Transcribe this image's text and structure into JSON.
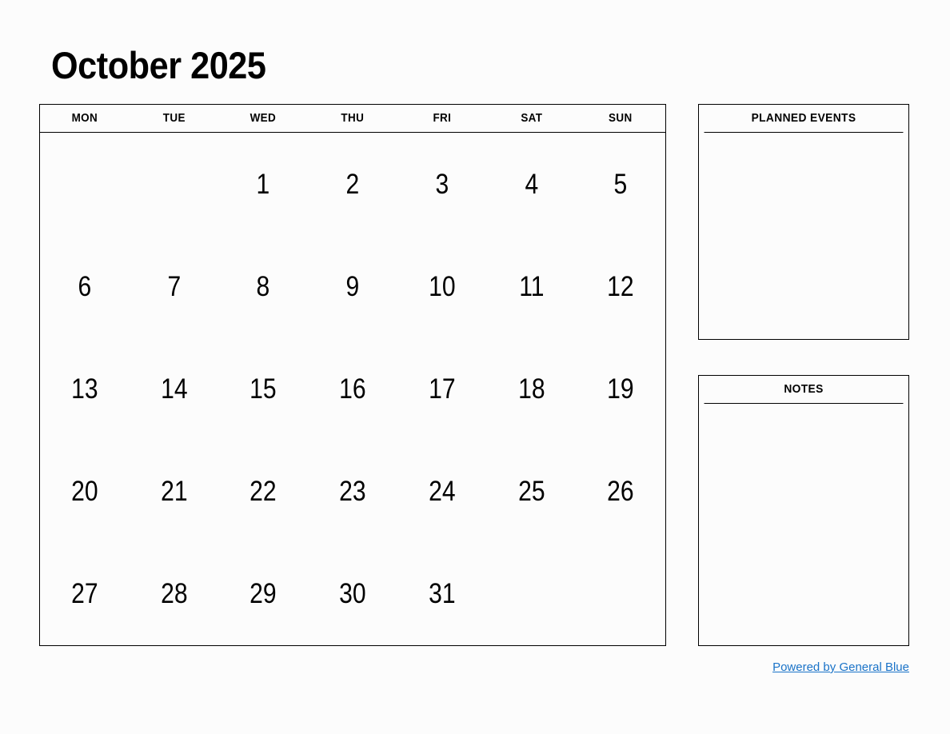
{
  "title": "October 2025",
  "calendar": {
    "weekdays": [
      "MON",
      "TUE",
      "WED",
      "THU",
      "FRI",
      "SAT",
      "SUN"
    ],
    "weeks": [
      [
        "",
        "",
        "1",
        "2",
        "3",
        "4",
        "5"
      ],
      [
        "6",
        "7",
        "8",
        "9",
        "10",
        "11",
        "12"
      ],
      [
        "13",
        "14",
        "15",
        "16",
        "17",
        "18",
        "19"
      ],
      [
        "20",
        "21",
        "22",
        "23",
        "24",
        "25",
        "26"
      ],
      [
        "27",
        "28",
        "29",
        "30",
        "31",
        "",
        ""
      ]
    ]
  },
  "planned_events": {
    "header": "PLANNED EVENTS",
    "content": ""
  },
  "notes": {
    "header": "NOTES",
    "content": ""
  },
  "footer": {
    "link_text": "Powered by General Blue",
    "link_color": "#1a73c8"
  },
  "colors": {
    "background": "#fcfcfc",
    "border": "#000000",
    "text": "#000000",
    "link": "#1a73c8"
  }
}
